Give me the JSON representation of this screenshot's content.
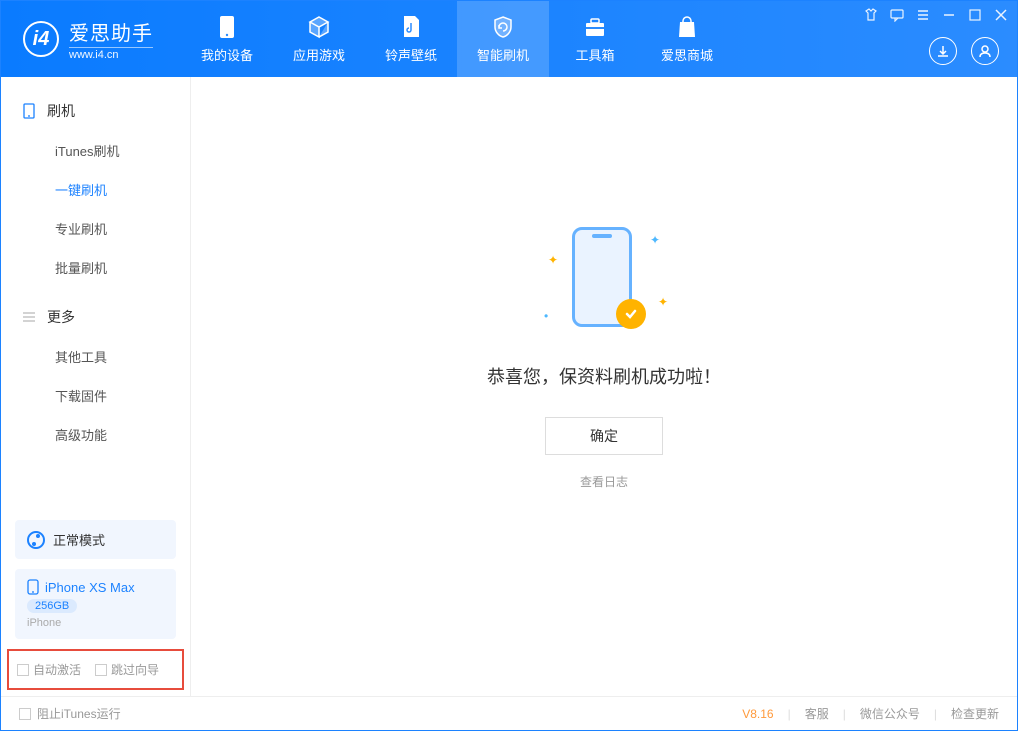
{
  "app": {
    "name": "爱思助手",
    "url": "www.i4.cn"
  },
  "tabs": [
    {
      "label": "我的设备"
    },
    {
      "label": "应用游戏"
    },
    {
      "label": "铃声壁纸"
    },
    {
      "label": "智能刷机"
    },
    {
      "label": "工具箱"
    },
    {
      "label": "爱思商城"
    }
  ],
  "sidebar": {
    "group1": "刷机",
    "items1": [
      "iTunes刷机",
      "一键刷机",
      "专业刷机",
      "批量刷机"
    ],
    "group2": "更多",
    "items2": [
      "其他工具",
      "下载固件",
      "高级功能"
    ]
  },
  "mode": {
    "label": "正常模式"
  },
  "device": {
    "name": "iPhone XS Max",
    "storage": "256GB",
    "type": "iPhone"
  },
  "checks": {
    "auto_activate": "自动激活",
    "skip_guide": "跳过向导"
  },
  "main": {
    "success": "恭喜您，保资料刷机成功啦！",
    "ok": "确定",
    "view_log": "查看日志"
  },
  "footer": {
    "block_itunes": "阻止iTunes运行",
    "version": "V8.16",
    "support": "客服",
    "wechat": "微信公众号",
    "update": "检查更新"
  }
}
